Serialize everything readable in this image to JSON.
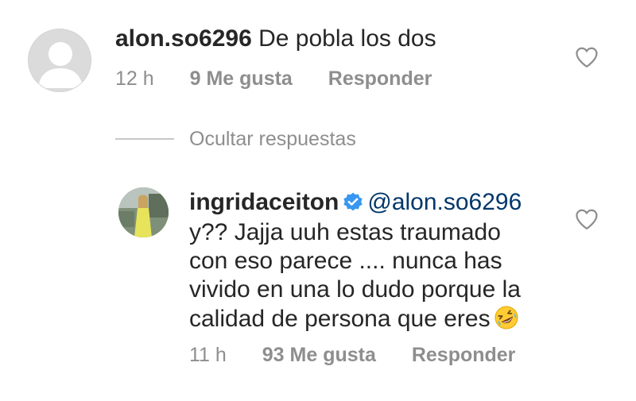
{
  "comment": {
    "username": "alon.so6296",
    "text": "De pobla los dos",
    "time": "12 h",
    "likes": "9 Me gusta",
    "reply_label": "Responder"
  },
  "replies_toggle": {
    "label": "Ocultar respuestas"
  },
  "reply": {
    "username": "ingridaceiton",
    "mention": "@alon.so6296",
    "lines": [
      "y?? Jajja uuh estas traumado",
      "con eso parece .... nunca has",
      "vivido en una lo dudo porque la",
      "calidad de persona que eres"
    ],
    "time": "11 h",
    "likes": "93 Me gusta",
    "reply_label": "Responder"
  },
  "icons": {
    "like": "heart-outline-icon",
    "verified": "verified-badge-icon",
    "emoji": "rolling-on-floor-laughing-emoji"
  },
  "colors": {
    "text": "#262626",
    "secondary": "#8e8e8e",
    "mention": "#00376b",
    "verified": "#3897f0"
  }
}
